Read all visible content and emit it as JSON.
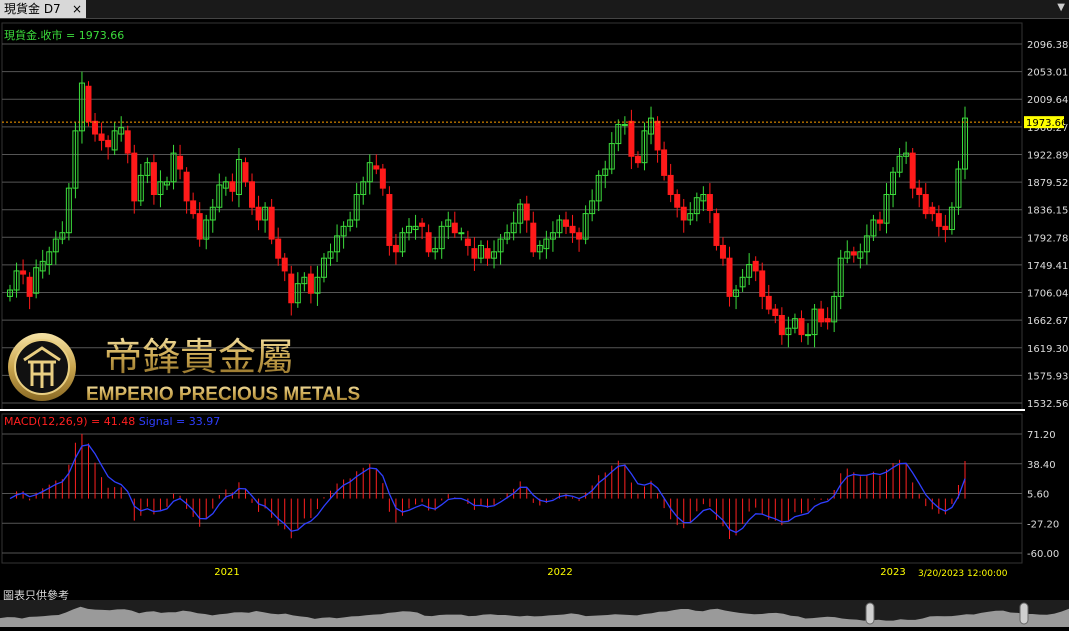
{
  "tab": {
    "title": "現貨金 D7",
    "close": "×"
  },
  "menu_arrow": "▼",
  "legend": {
    "price": "現貨金.收市 = 1973.66",
    "macd": "MACD(12,26,9) = 41.48",
    "signal": "Signal = 33.97"
  },
  "disclaimer": "圖表只供參考",
  "logo": {
    "chinese": "帝鋒貴金屬",
    "english": "EMPERIO PRECIOUS METALS"
  },
  "colors": {
    "up": "#3cdc3c",
    "down": "#ff1a1a",
    "grid": "#555555",
    "price_line": "#ff9f00",
    "highlight": "#ffff00",
    "signal": "#2f3fff",
    "macd": "#ff2020"
  },
  "chart_data": [
    {
      "type": "candlestick",
      "series_name": "現貨金",
      "ylim": [
        1532.56,
        2096.38
      ],
      "y_ticks": [
        "2096.38",
        "2053.01",
        "2009.64",
        "1966.27",
        "1922.89",
        "1879.52",
        "1836.15",
        "1792.78",
        "1749.41",
        "1706.04",
        "1662.67",
        "1619.30",
        "1575.93",
        "1532.56"
      ],
      "last_close": "1973.66",
      "x_ticks": [
        "2021",
        "2022",
        "2023"
      ],
      "cursor_label": "3/20/2023 12:00:00",
      "closes": [
        1710,
        1740,
        1735,
        1700,
        1745,
        1755,
        1770,
        1790,
        1800,
        1870,
        1960,
        2035,
        1975,
        1955,
        1945,
        1935,
        1960,
        1965,
        1925,
        1850,
        1890,
        1910,
        1860,
        1880,
        1880,
        1925,
        1900,
        1850,
        1830,
        1790,
        1820,
        1840,
        1875,
        1880,
        1865,
        1915,
        1880,
        1840,
        1820,
        1840,
        1790,
        1760,
        1740,
        1690,
        1720,
        1730,
        1705,
        1730,
        1760,
        1770,
        1795,
        1810,
        1820,
        1860,
        1880,
        1910,
        1900,
        1870,
        1780,
        1770,
        1800,
        1810,
        1810,
        1810,
        1770,
        1775,
        1810,
        1820,
        1800,
        1800,
        1780,
        1760,
        1780,
        1760,
        1770,
        1790,
        1800,
        1815,
        1845,
        1820,
        1770,
        1780,
        1790,
        1800,
        1820,
        1810,
        1800,
        1790,
        1830,
        1850,
        1890,
        1900,
        1940,
        1970,
        1970,
        1920,
        1910,
        1960,
        1980,
        1930,
        1890,
        1860,
        1840,
        1820,
        1830,
        1855,
        1860,
        1835,
        1780,
        1760,
        1700,
        1710,
        1730,
        1750,
        1740,
        1700,
        1680,
        1670,
        1640,
        1650,
        1665,
        1640,
        1640,
        1680,
        1660,
        1660,
        1700,
        1760,
        1770,
        1765,
        1770,
        1795,
        1820,
        1815,
        1860,
        1895,
        1920,
        1925,
        1870,
        1860,
        1830,
        1830,
        1810,
        1805,
        1840,
        1900,
        1980
      ],
      "opens": [
        1700,
        1710,
        1740,
        1730,
        1705,
        1740,
        1750,
        1770,
        1790,
        1800,
        1870,
        1960,
        2030,
        1975,
        1955,
        1945,
        1930,
        1955,
        1960,
        1925,
        1850,
        1890,
        1910,
        1860,
        1875,
        1880,
        1920,
        1895,
        1850,
        1830,
        1790,
        1820,
        1840,
        1870,
        1880,
        1860,
        1910,
        1880,
        1840,
        1820,
        1840,
        1790,
        1760,
        1735,
        1690,
        1720,
        1735,
        1705,
        1730,
        1760,
        1770,
        1795,
        1810,
        1820,
        1860,
        1880,
        1905,
        1900,
        1860,
        1780,
        1770,
        1800,
        1805,
        1815,
        1800,
        1770,
        1775,
        1810,
        1815,
        1800,
        1790,
        1775,
        1760,
        1775,
        1760,
        1770,
        1790,
        1800,
        1815,
        1845,
        1815,
        1770,
        1775,
        1790,
        1800,
        1820,
        1810,
        1800,
        1790,
        1830,
        1850,
        1890,
        1900,
        1940,
        1970,
        1975,
        1920,
        1910,
        1955,
        1975,
        1930,
        1890,
        1860,
        1840,
        1820,
        1830,
        1850,
        1860,
        1830,
        1780,
        1760,
        1700,
        1715,
        1730,
        1755,
        1740,
        1700,
        1680,
        1670,
        1640,
        1650,
        1665,
        1640,
        1640,
        1680,
        1665,
        1660,
        1700,
        1760,
        1770,
        1760,
        1770,
        1795,
        1820,
        1815,
        1860,
        1895,
        1920,
        1925,
        1870,
        1860,
        1840,
        1830,
        1810,
        1805,
        1840,
        1900
      ],
      "macd_ylim": [
        -60.0,
        71.2
      ],
      "macd_ticks": [
        "71.20",
        "38.40",
        "5.60",
        "-27.20",
        "-60.00"
      ],
      "macd_last": 41.48,
      "signal_last": 33.97
    }
  ]
}
